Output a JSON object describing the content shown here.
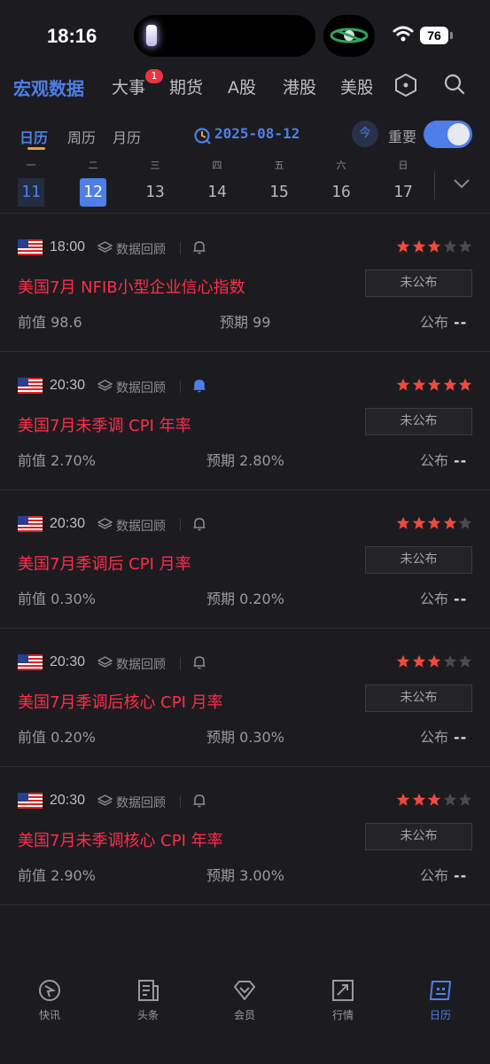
{
  "status_bar": {
    "time": "18:16",
    "battery": "76"
  },
  "top_nav": {
    "tabs": [
      {
        "label": "宏观数据",
        "active": true
      },
      {
        "label": "大事",
        "badge": "1"
      },
      {
        "label": "期货"
      },
      {
        "label": "A股"
      },
      {
        "label": "港股"
      },
      {
        "label": "美股"
      }
    ]
  },
  "sub_tabs": [
    "日历",
    "周历",
    "月历"
  ],
  "date_picker": "2025-08-12",
  "today_label": "今",
  "important_label": "重要",
  "week": [
    {
      "weekday": "一",
      "day": "11",
      "state": "past"
    },
    {
      "weekday": "二",
      "day": "12",
      "state": "selected"
    },
    {
      "weekday": "三",
      "day": "13",
      "state": ""
    },
    {
      "weekday": "四",
      "day": "14",
      "state": ""
    },
    {
      "weekday": "五",
      "day": "15",
      "state": ""
    },
    {
      "weekday": "六",
      "day": "16",
      "state": ""
    },
    {
      "weekday": "日",
      "day": "17",
      "state": ""
    }
  ],
  "events": [
    {
      "time": "18:00",
      "review": "数据回顾",
      "bell_active": false,
      "stars": 3,
      "title": "美国7月 NFIB小型企业信心指数",
      "status": "未公布",
      "prev_label": "前值",
      "prev": "98.6",
      "forecast_label": "预期",
      "forecast": "99",
      "pub_label": "公布",
      "pub": "--"
    },
    {
      "time": "20:30",
      "review": "数据回顾",
      "bell_active": true,
      "stars": 5,
      "title": "美国7月未季调 CPI 年率",
      "status": "未公布",
      "prev_label": "前值",
      "prev": "2.70%",
      "forecast_label": "预期",
      "forecast": "2.80%",
      "pub_label": "公布",
      "pub": "--"
    },
    {
      "time": "20:30",
      "review": "数据回顾",
      "bell_active": false,
      "stars": 4,
      "title": "美国7月季调后 CPI 月率",
      "status": "未公布",
      "prev_label": "前值",
      "prev": "0.30%",
      "forecast_label": "预期",
      "forecast": "0.20%",
      "pub_label": "公布",
      "pub": "--"
    },
    {
      "time": "20:30",
      "review": "数据回顾",
      "bell_active": false,
      "stars": 3,
      "title": "美国7月季调后核心 CPI 月率",
      "status": "未公布",
      "prev_label": "前值",
      "prev": "0.20%",
      "forecast_label": "预期",
      "forecast": "0.30%",
      "pub_label": "公布",
      "pub": "--"
    },
    {
      "time": "20:30",
      "review": "数据回顾",
      "bell_active": false,
      "stars": 3,
      "title": "美国7月未季调核心 CPI 年率",
      "status": "未公布",
      "prev_label": "前值",
      "prev": "2.90%",
      "forecast_label": "预期",
      "forecast": "3.00%",
      "pub_label": "公布",
      "pub": "--"
    }
  ],
  "bottom_nav": [
    {
      "label": "快讯",
      "icon": "flash-news-icon"
    },
    {
      "label": "头条",
      "icon": "headline-icon"
    },
    {
      "label": "会员",
      "icon": "diamond-icon"
    },
    {
      "label": "行情",
      "icon": "chart-icon"
    },
    {
      "label": "日历",
      "icon": "calendar-icon",
      "active": true
    }
  ],
  "colors": {
    "accent": "#4e7ee8",
    "title_red": "#ff2d4b",
    "star_red": "#f04a3c",
    "underline_gold": "#e5a33a"
  }
}
